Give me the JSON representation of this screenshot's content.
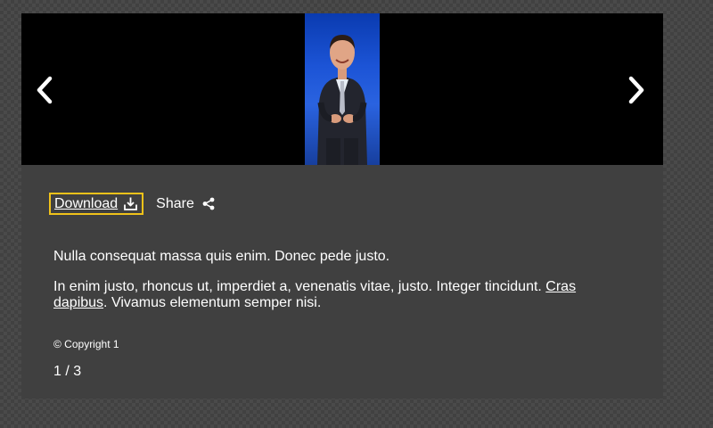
{
  "gallery": {
    "prev_icon": "chevron-left-icon",
    "next_icon": "chevron-right-icon",
    "counter": "1 / 3"
  },
  "actions": {
    "download_label": "Download",
    "download_icon": "download-icon",
    "share_label": "Share",
    "share_icon": "share-icon"
  },
  "caption": {
    "paragraph1": "Nulla consequat massa quis enim. Donec pede justo.",
    "paragraph2_before_link": "In enim justo, rhoncus ut, imperdiet a, venenatis vitae, justo. Integer tincidunt. ",
    "paragraph2_link": "Cras dapibus",
    "paragraph2_after_link": ". Vivamus elementum semper nisi.",
    "copyright": "© Copyright 1"
  },
  "colors": {
    "focus_outline": "#f0c21a",
    "panel_background": "#404040",
    "stage_background": "#000000"
  }
}
